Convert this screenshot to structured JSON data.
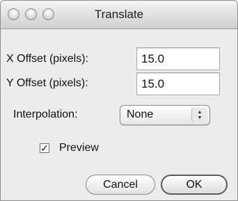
{
  "window": {
    "title": "Translate"
  },
  "fields": {
    "x_offset": {
      "label": "X Offset (pixels):",
      "value": "15.0"
    },
    "y_offset": {
      "label": "Y Offset (pixels):",
      "value": "15.0"
    }
  },
  "interpolation": {
    "label": "Interpolation:",
    "selected": "None"
  },
  "preview": {
    "label": "Preview",
    "checked": true
  },
  "buttons": {
    "cancel": "Cancel",
    "ok": "OK"
  }
}
